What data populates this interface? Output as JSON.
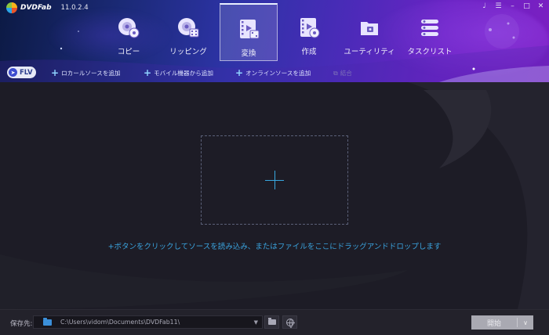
{
  "app": {
    "name": "DVDFab",
    "version": "11.0.2.4"
  },
  "window_controls": [
    "bell-icon",
    "settings-icon",
    "minimize-icon",
    "restore-icon",
    "close-icon"
  ],
  "tabs": [
    {
      "label": "コピー",
      "icon": "disc-copy-icon",
      "active": false
    },
    {
      "label": "リッピング",
      "icon": "disc-rip-icon",
      "active": false
    },
    {
      "label": "変換",
      "icon": "film-convert-icon",
      "active": true
    },
    {
      "label": "作成",
      "icon": "film-create-icon",
      "active": false
    },
    {
      "label": "ユーティリティ",
      "icon": "toolbox-icon",
      "active": false
    },
    {
      "label": "タスクリスト",
      "icon": "task-list-icon",
      "active": false
    }
  ],
  "toolbar": {
    "profile_label": "FLV",
    "add_local": "ロカールソースを追加",
    "add_mobile": "モバイル機器から追加",
    "add_online": "オンラインソースを追加",
    "merge": "結合"
  },
  "main": {
    "hint": "+ボタンをクリックしてソースを読み込み、またはファイルをここにドラッグアンドドロップします"
  },
  "footer": {
    "save_label": "保存先:",
    "save_path": "C:\\Users\\vidom\\Documents\\DVDFab11\\",
    "start_label": "開始"
  },
  "colors": {
    "accent": "#38a8e0",
    "header_start": "#0c1a44",
    "header_end": "#7b1fc2"
  }
}
